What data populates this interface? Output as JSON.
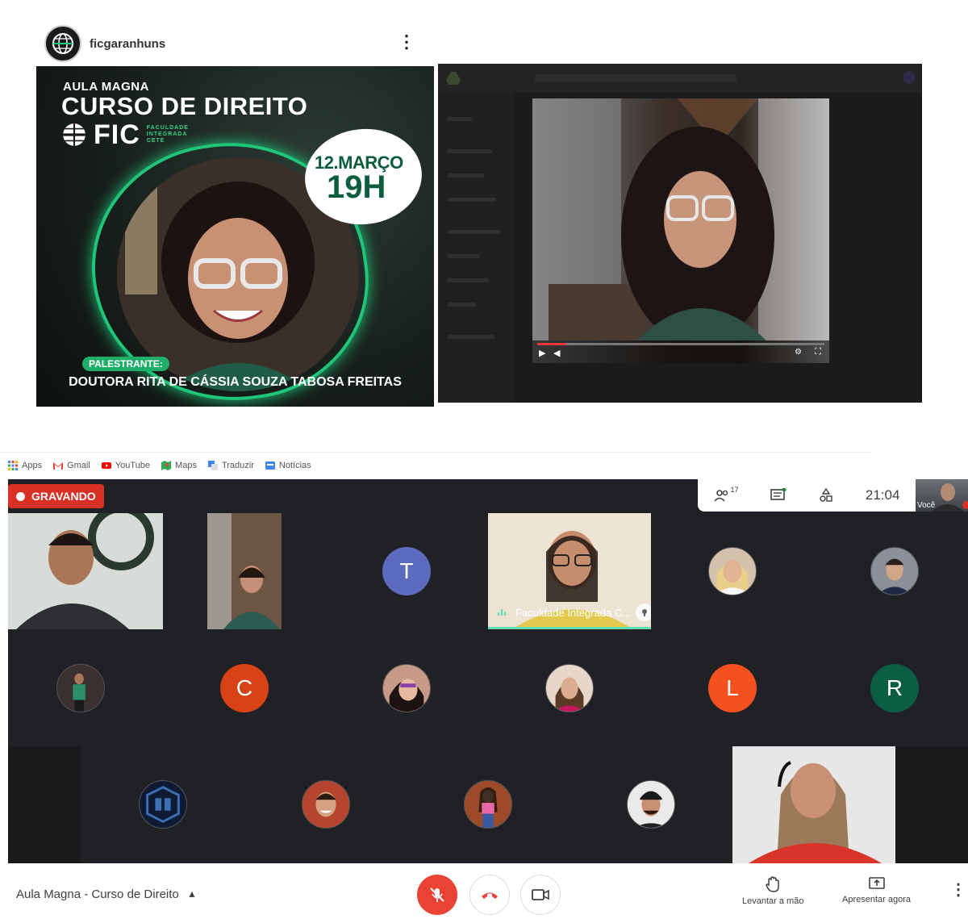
{
  "instagram_post": {
    "username": "ficgaranhuns",
    "poster": {
      "line1": "AULA MAGNA",
      "line2": "CURSO DE DIREITO",
      "logo_text": "FIC",
      "logo_sub": "FACULDADE\nINTEGRADA\nCETE",
      "date": "12.MARÇO",
      "time": "19H",
      "speaker_label": "PALESTRANTE:",
      "speaker_name": "DOUTORA RITA DE CÁSSIA SOUZA TABOSA FREITAS"
    }
  },
  "screen_share": {
    "video_progress": 0.1
  },
  "bookmarks": [
    {
      "label": "Apps",
      "icon": "apps-grid-icon"
    },
    {
      "label": "Gmail",
      "icon": "gmail-icon"
    },
    {
      "label": "YouTube",
      "icon": "youtube-icon"
    },
    {
      "label": "Maps",
      "icon": "maps-icon"
    },
    {
      "label": "Traduzir",
      "icon": "translate-icon"
    },
    {
      "label": "Notícias",
      "icon": "news-icon"
    }
  ],
  "meet": {
    "recording_label": "GRAVANDO",
    "participant_count": "17",
    "time": "21:04",
    "self_label": "Você",
    "active_speaker": "Faculdade Integrada C...",
    "avatars": [
      {
        "letter": "T",
        "color": "#5c6bc0"
      },
      {
        "letter": "C",
        "color": "#d84315"
      },
      {
        "letter": "L",
        "color": "#f4511e"
      },
      {
        "letter": "R",
        "color": "#0b5d44"
      }
    ]
  },
  "bottom_bar": {
    "meeting_title": "Aula Magna - Curso de Direito",
    "raise_hand": "Levantar a mão",
    "present_now": "Apresentar agora"
  },
  "colors": {
    "meet_bg": "#202124",
    "recording_red": "#d93025",
    "speaking_green": "#5ee0b7",
    "brand_green": "#1fc67a"
  }
}
